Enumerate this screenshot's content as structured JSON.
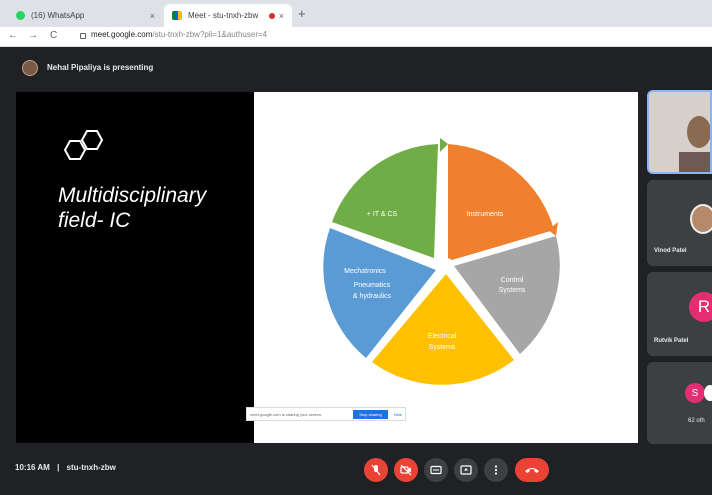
{
  "browser": {
    "tabs": [
      {
        "title": "(16) WhatsApp",
        "active": false
      },
      {
        "title": "Meet - stu-tnxh-zbw",
        "active": true
      }
    ],
    "new_tab": "+",
    "nav": {
      "back": "←",
      "forward": "→",
      "reload": "C"
    },
    "url_host": "meet.google.com",
    "url_path": "/stu-tnxh-zbw?pli=1&authuser=4"
  },
  "meet": {
    "presenter_text": "Nehal Pipaliya is presenting",
    "slide": {
      "title": "Multidisciplinary field- IC",
      "pie_segments": [
        {
          "label": "Instruments",
          "color": "#f07f2e"
        },
        {
          "label": "Control Systems",
          "color": "#a6a6a6"
        },
        {
          "label": "Electrical Systems",
          "color": "#ffc000"
        },
        {
          "label": "Mechatronics\nPneumatics\n& hydraulics",
          "color": "#5b9bd5"
        },
        {
          "label": "+ IT & CS",
          "color": "#70ad47"
        }
      ]
    },
    "share_banner": {
      "text": "meet.google.com is sharing your screen.",
      "stop": "Stop sharing",
      "hide": "Hide"
    },
    "participants": [
      {
        "name": "Vinod Patel"
      },
      {
        "name": "Rutvik Patel",
        "initial": "R"
      },
      {
        "initial": "S",
        "more": "62 oth"
      }
    ],
    "meeting_time": "10:16 AM",
    "meeting_code": "stu-tnxh-zbw",
    "separator": "|",
    "colors": {
      "accent_red": "#ea4335",
      "accent_blue": "#8ab4f8",
      "rutvik": "#e52e71",
      "s_avatar": "#e52e71"
    }
  }
}
